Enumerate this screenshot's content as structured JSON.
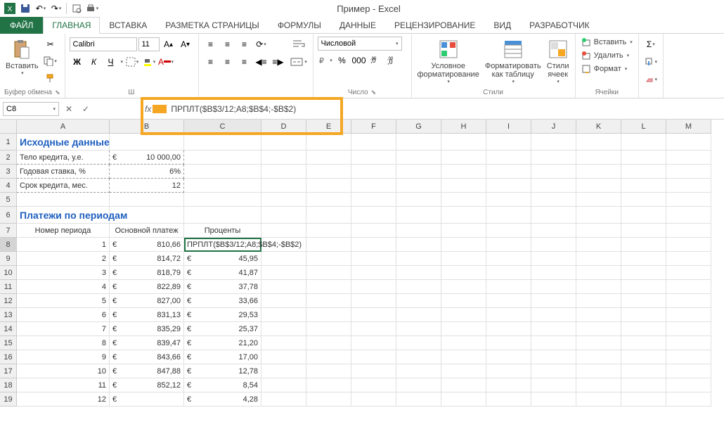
{
  "app_title": "Пример - Excel",
  "tabs": {
    "file": "ФАЙЛ",
    "home": "ГЛАВНАЯ",
    "insert": "ВСТАВКА",
    "layout": "РАЗМЕТКА СТРАНИЦЫ",
    "formulas": "ФОРМУЛЫ",
    "data": "ДАННЫЕ",
    "review": "РЕЦЕНЗИРОВАНИЕ",
    "view": "ВИД",
    "developer": "РАЗРАБОТЧИК"
  },
  "ribbon": {
    "clipboard": {
      "paste": "Вставить",
      "label": "Буфер обмена"
    },
    "font": {
      "family": "Calibri",
      "size": "11",
      "bold": "Ж",
      "italic": "К",
      "underline": "Ч",
      "label": "Ш"
    },
    "alignment": {
      "label": ""
    },
    "number": {
      "format": "Числовой",
      "label": "Число"
    },
    "styles": {
      "cond": "Условное\nформатирование",
      "table": "Форматировать\nкак таблицу",
      "cell": "Стили\nячеек",
      "label": "Стили"
    },
    "cells": {
      "insert": "Вставить",
      "delete": "Удалить",
      "format": "Формат",
      "label": "Ячейки"
    }
  },
  "name_box": "C8",
  "formula_text": "ПРПЛТ($B$3/12;A8;$B$4;-$B$2)",
  "columns": [
    "A",
    "B",
    "C",
    "D",
    "E",
    "F",
    "G",
    "H",
    "I",
    "J",
    "K",
    "L",
    "M"
  ],
  "rows": [
    "1",
    "2",
    "3",
    "4",
    "5",
    "6",
    "7",
    "8",
    "9",
    "10",
    "11",
    "12",
    "13",
    "14",
    "15",
    "16",
    "17",
    "18",
    "19"
  ],
  "headings": {
    "source": "Исходные данные",
    "payments": "Платежи по периодам"
  },
  "source_data": [
    {
      "label": "Тело кредита, у.е.",
      "cur": "€",
      "val": "10 000,00"
    },
    {
      "label": "Годовая ставка, %",
      "cur": "",
      "val": "6%"
    },
    {
      "label": "Срок кредита, мес.",
      "cur": "",
      "val": "12"
    }
  ],
  "table_headers": [
    "Номер периода",
    "Основной платеж",
    "Проценты"
  ],
  "active_cell_display": "ПРПЛТ($B$3/12;A8;$B$4;-$B$2)",
  "payments": [
    {
      "n": "1",
      "cur": "€",
      "principal": "810,66"
    },
    {
      "n": "2",
      "cur": "€",
      "principal": "814,72",
      "icur": "€",
      "interest": "45,95"
    },
    {
      "n": "3",
      "cur": "€",
      "principal": "818,79",
      "icur": "€",
      "interest": "41,87"
    },
    {
      "n": "4",
      "cur": "€",
      "principal": "822,89",
      "icur": "€",
      "interest": "37,78"
    },
    {
      "n": "5",
      "cur": "€",
      "principal": "827,00",
      "icur": "€",
      "interest": "33,66"
    },
    {
      "n": "6",
      "cur": "€",
      "principal": "831,13",
      "icur": "€",
      "interest": "29,53"
    },
    {
      "n": "7",
      "cur": "€",
      "principal": "835,29",
      "icur": "€",
      "interest": "25,37"
    },
    {
      "n": "8",
      "cur": "€",
      "principal": "839,47",
      "icur": "€",
      "interest": "21,20"
    },
    {
      "n": "9",
      "cur": "€",
      "principal": "843,66",
      "icur": "€",
      "interest": "17,00"
    },
    {
      "n": "10",
      "cur": "€",
      "principal": "847,88",
      "icur": "€",
      "interest": "12,78"
    },
    {
      "n": "11",
      "cur": "€",
      "principal": "852,12",
      "icur": "€",
      "interest": "8,54"
    },
    {
      "n": "12",
      "cur": "€",
      "principal": "",
      "icur": "€",
      "interest": "4,28"
    }
  ]
}
